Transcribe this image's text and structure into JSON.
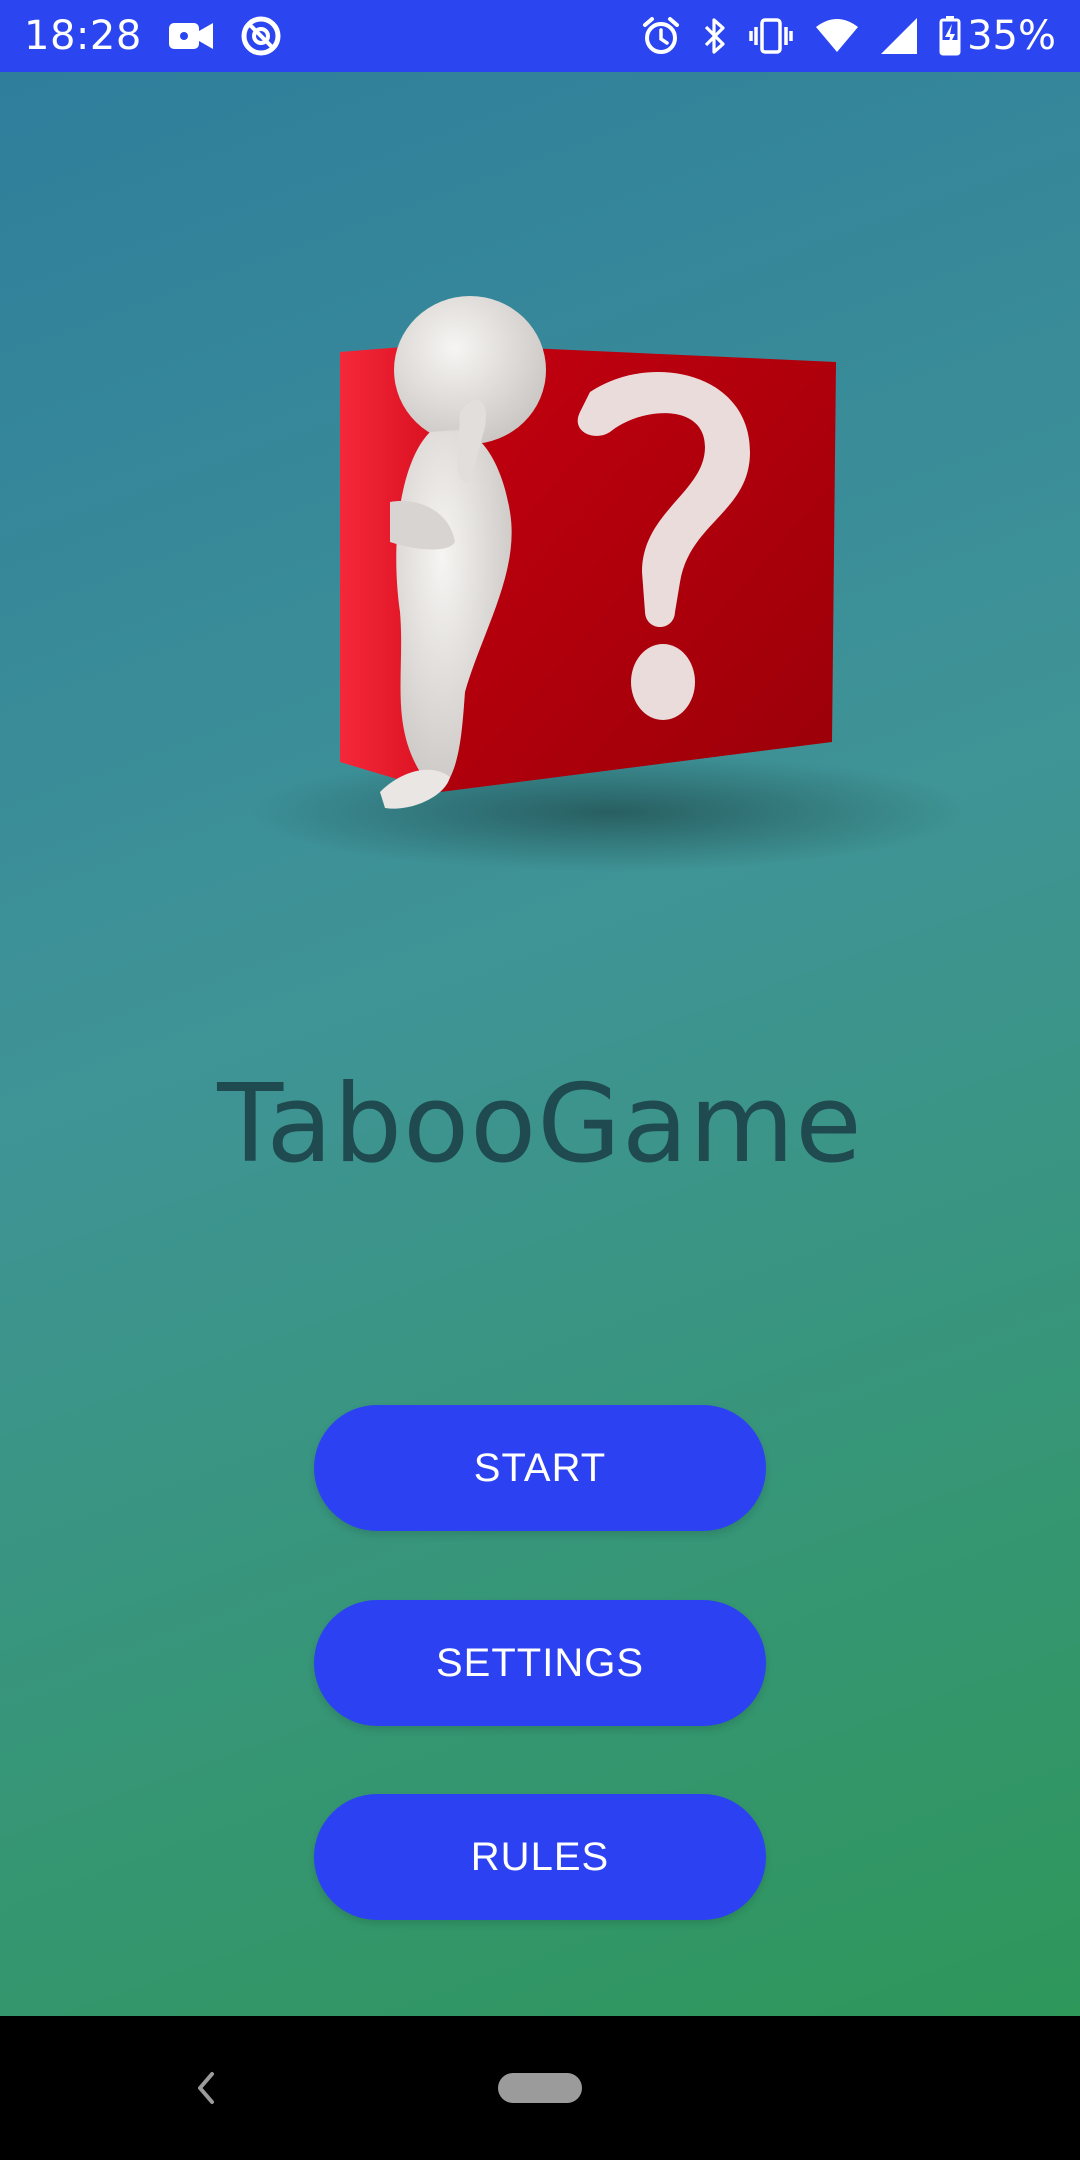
{
  "colors": {
    "status_bar": "#2B45F0",
    "bg_top": "#2F7E9C",
    "bg_mid": "#3F9496",
    "bg_bottom": "#2E975A",
    "button": "#2C42F2",
    "title": "#1F4A4F",
    "cube_red": "#C4000C",
    "figure": "#E7E4E2",
    "nav_home": "#9B9B9B"
  },
  "status_bar": {
    "time": "18:28",
    "battery_percent": "35%",
    "icons_left": [
      "video-camera-icon",
      "sync-icon"
    ],
    "icons_right": [
      "alarm-icon",
      "bluetooth-icon",
      "vibrate-icon",
      "wifi-icon",
      "signal-icon",
      "battery-charging-icon"
    ]
  },
  "hero": {
    "icon": "question-mark-figure-illustration"
  },
  "app": {
    "title": "TabooGame"
  },
  "buttons": {
    "start": "START",
    "settings": "SETTINGS",
    "rules": "RULES"
  },
  "nav": {
    "icons": [
      "back-icon",
      "home-pill-icon"
    ]
  }
}
